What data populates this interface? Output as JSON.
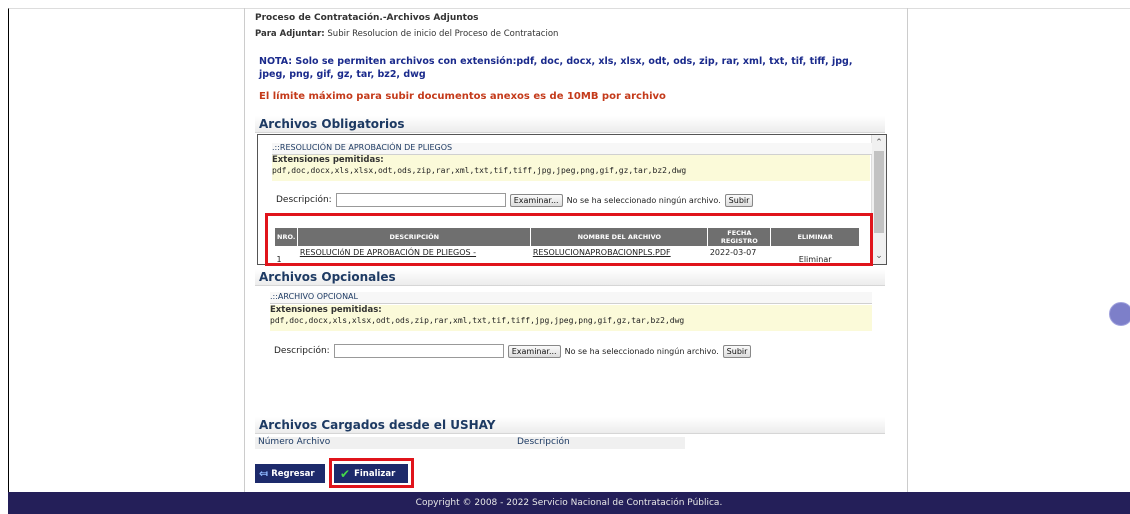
{
  "header": {
    "title": "Proceso de Contratación.-Archivos Adjuntos",
    "adjuntar_label": "Para Adjuntar:",
    "adjuntar_value": "Subir Resolucion de inicio del Proceso de Contratacion"
  },
  "nota": "NOTA: Solo se permiten archivos con extensión:pdf, doc, docx, xls, xlsx, odt, ods, zip, rar, xml, txt, tif, tiff, jpg, jpeg, png, gif, gz, tar, bz2, dwg",
  "limite": "El límite máximo para subir documentos anexos es de 10MB por archivo",
  "obligatorios": {
    "title": "Archivos Obligatorios",
    "doc_label": ".::RESOLUCIÓN DE APROBACIÓN DE PLIEGOS",
    "ext_title": "Extensiones pemitidas:",
    "ext_list": "pdf,doc,docx,xls,xlsx,odt,ods,zip,rar,xml,txt,tif,tiff,jpg,jpeg,png,gif,gz,tar,bz2,dwg",
    "desc_label": "Descripción:",
    "browse_label": "Examinar...",
    "no_file": "No se ha seleccionado ningún archivo.",
    "upload_label": "Subir",
    "table": {
      "headers": [
        "NRO.",
        "DESCRIPCIÓN",
        "NOMBRE DEL ARCHIVO",
        "FECHA REGISTRO",
        "ELIMINAR"
      ],
      "rows": [
        {
          "nro": "1",
          "descripcion": "RESOLUCIóN DE APROBACIÓN DE PLIEGOS -",
          "archivo": "RESOLUCIONAPROBACIONPLS.PDF",
          "fecha": "2022-03-07",
          "eliminar": "Eliminar"
        }
      ]
    }
  },
  "opcionales": {
    "title": "Archivos Opcionales",
    "doc_label": ".::ARCHIVO OPCIONAL",
    "ext_title": "Extensiones pemitidas:",
    "ext_list": "pdf,doc,docx,xls,xlsx,odt,ods,zip,rar,xml,txt,tif,tiff,jpg,jpeg,png,gif,gz,tar,bz2,dwg",
    "desc_label": "Descripción:",
    "browse_label": "Examinar...",
    "no_file": "No se ha seleccionado ningún archivo.",
    "upload_label": "Subir"
  },
  "cargados": {
    "title": "Archivos Cargados desde el USHAY",
    "col_numero": "Número Archivo",
    "col_descripcion": "Descripción"
  },
  "buttons": {
    "regresar": "Regresar",
    "finalizar": "Finalizar"
  },
  "footer": "Copyright © 2008 - 2022 Servicio Nacional de Contratación Pública."
}
